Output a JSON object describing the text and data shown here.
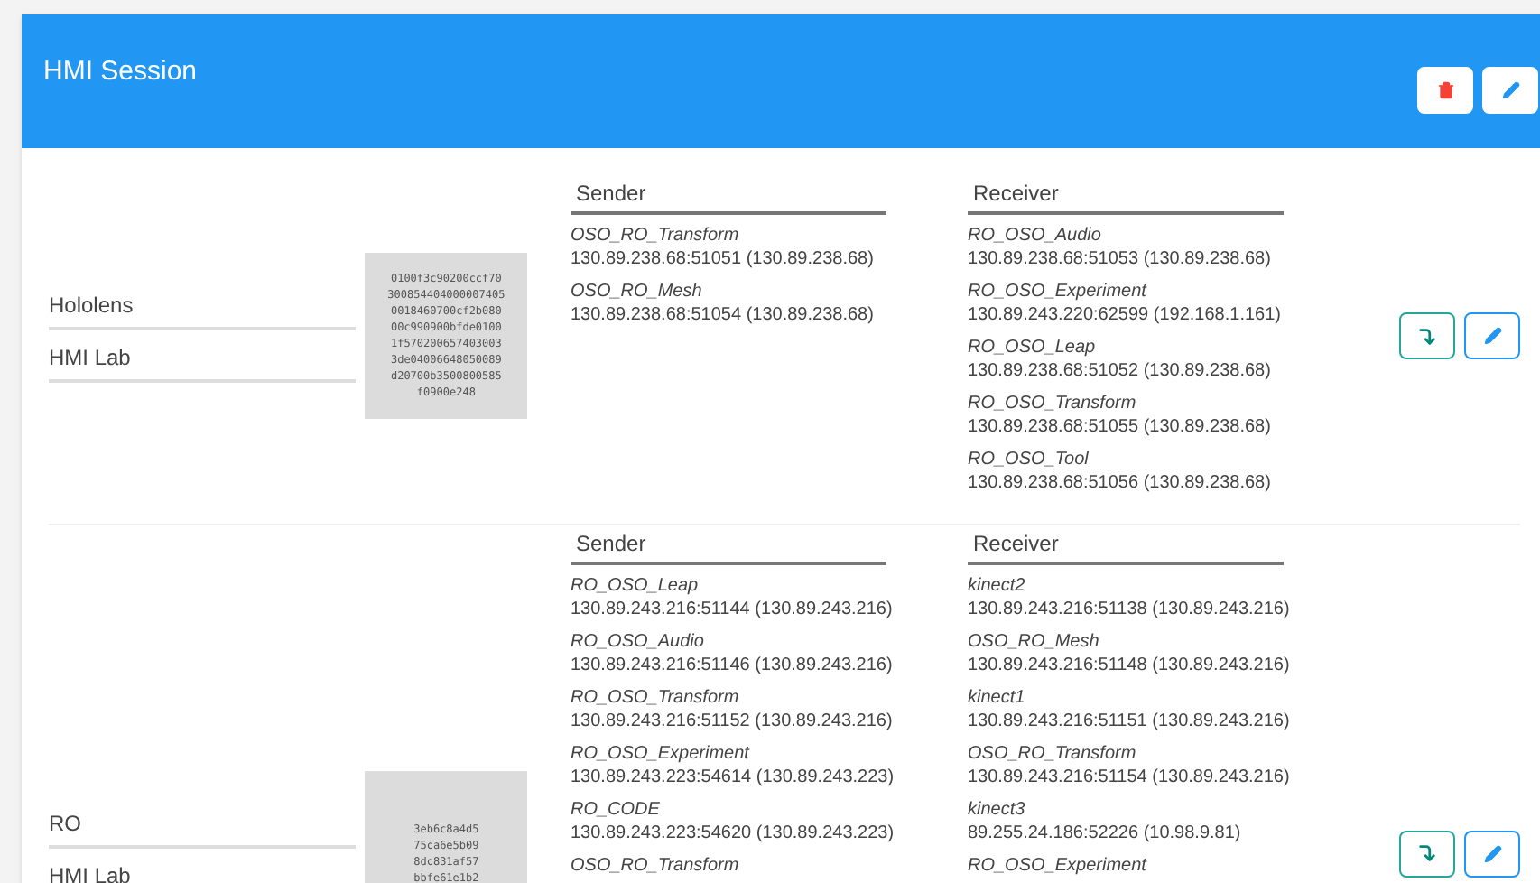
{
  "header": {
    "title": "HMI Session"
  },
  "sessions": [
    {
      "name": "Hololens",
      "location": "HMI Lab",
      "id_lines": [
        "0100f3c90200ccf70",
        "300854404000007405",
        "0018460700cf2b080",
        "00c990900bfde0100",
        "1f570200657403003",
        "3de04006648050089",
        "d20700b3500800585",
        "f0900e248"
      ],
      "sender": {
        "title": "Sender",
        "items": [
          {
            "name": "OSO_RO_Transform",
            "address": "130.89.238.68:51051 (130.89.238.68)"
          },
          {
            "name": "OSO_RO_Mesh",
            "address": "130.89.238.68:51054 (130.89.238.68)"
          }
        ]
      },
      "receiver": {
        "title": "Receiver",
        "items": [
          {
            "name": "RO_OSO_Audio",
            "address": "130.89.238.68:51053 (130.89.238.68)"
          },
          {
            "name": "RO_OSO_Experiment",
            "address": "130.89.243.220:62599 (192.168.1.161)"
          },
          {
            "name": "RO_OSO_Leap",
            "address": "130.89.238.68:51052 (130.89.238.68)"
          },
          {
            "name": "RO_OSO_Transform",
            "address": "130.89.238.68:51055 (130.89.238.68)"
          },
          {
            "name": "RO_OSO_Tool",
            "address": "130.89.238.68:51056 (130.89.238.68)"
          }
        ]
      }
    },
    {
      "name": "RO",
      "location": "HMI Lab",
      "id_lines": [
        "3eb6c8a4d5",
        "75ca6e5b09",
        "8dc831af57",
        "bbfe61e1b2"
      ],
      "sender": {
        "title": "Sender",
        "items": [
          {
            "name": "RO_OSO_Leap",
            "address": "130.89.243.216:51144 (130.89.243.216)"
          },
          {
            "name": "RO_OSO_Audio",
            "address": "130.89.243.216:51146 (130.89.243.216)"
          },
          {
            "name": "RO_OSO_Transform",
            "address": "130.89.243.216:51152 (130.89.243.216)"
          },
          {
            "name": "RO_OSO_Experiment",
            "address": "130.89.243.223:54614 (130.89.243.223)"
          },
          {
            "name": "RO_CODE",
            "address": "130.89.243.223:54620 (130.89.243.223)"
          },
          {
            "name": "OSO_RO_Transform"
          }
        ]
      },
      "receiver": {
        "title": "Receiver",
        "items": [
          {
            "name": "kinect2",
            "address": "130.89.243.216:51138 (130.89.243.216)"
          },
          {
            "name": "OSO_RO_Mesh",
            "address": "130.89.243.216:51148 (130.89.243.216)"
          },
          {
            "name": "kinect1",
            "address": "130.89.243.216:51151 (130.89.243.216)"
          },
          {
            "name": "OSO_RO_Transform",
            "address": "130.89.243.216:51154 (130.89.243.216)"
          },
          {
            "name": "kinect3",
            "address": "89.255.24.186:52226 (10.98.9.81)"
          },
          {
            "name": "RO_OSO_Experiment"
          }
        ]
      }
    }
  ]
}
